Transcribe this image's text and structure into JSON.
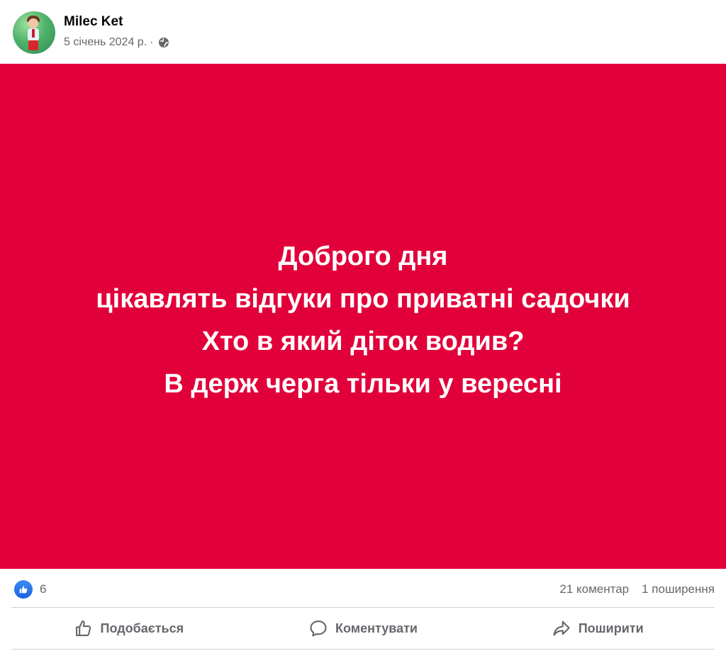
{
  "post": {
    "author": "Milec Ket",
    "date": "5 січень 2024 р.",
    "separator": "·",
    "privacy_icon": "globe-icon",
    "image": {
      "background": "#e1003a",
      "lines": [
        "Доброго дня",
        "цікавлять відгуки про приватні садочки",
        "Хто в який діток водив?",
        "В держ черга тільки у вересні"
      ]
    }
  },
  "stats": {
    "reaction_icon": "like-icon",
    "reaction_count": "6",
    "comments": "21 коментар",
    "shares": "1 поширення"
  },
  "actions": {
    "like": "Подобається",
    "comment": "Коментувати",
    "share": "Поширити"
  }
}
